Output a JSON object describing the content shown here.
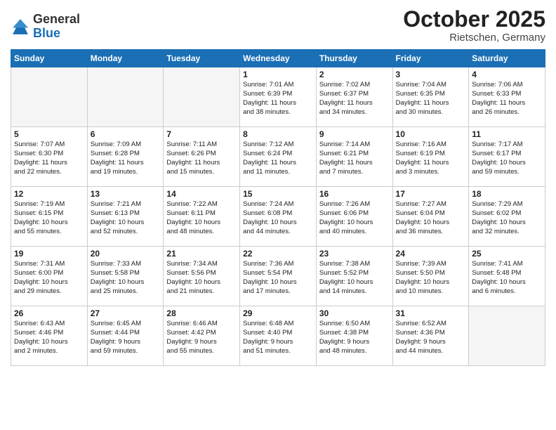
{
  "header": {
    "logo_general": "General",
    "logo_blue": "Blue",
    "month": "October 2025",
    "location": "Rietschen, Germany"
  },
  "weekdays": [
    "Sunday",
    "Monday",
    "Tuesday",
    "Wednesday",
    "Thursday",
    "Friday",
    "Saturday"
  ],
  "weeks": [
    [
      {
        "day": "",
        "info": ""
      },
      {
        "day": "",
        "info": ""
      },
      {
        "day": "",
        "info": ""
      },
      {
        "day": "1",
        "info": "Sunrise: 7:01 AM\nSunset: 6:39 PM\nDaylight: 11 hours\nand 38 minutes."
      },
      {
        "day": "2",
        "info": "Sunrise: 7:02 AM\nSunset: 6:37 PM\nDaylight: 11 hours\nand 34 minutes."
      },
      {
        "day": "3",
        "info": "Sunrise: 7:04 AM\nSunset: 6:35 PM\nDaylight: 11 hours\nand 30 minutes."
      },
      {
        "day": "4",
        "info": "Sunrise: 7:06 AM\nSunset: 6:33 PM\nDaylight: 11 hours\nand 26 minutes."
      }
    ],
    [
      {
        "day": "5",
        "info": "Sunrise: 7:07 AM\nSunset: 6:30 PM\nDaylight: 11 hours\nand 22 minutes."
      },
      {
        "day": "6",
        "info": "Sunrise: 7:09 AM\nSunset: 6:28 PM\nDaylight: 11 hours\nand 19 minutes."
      },
      {
        "day": "7",
        "info": "Sunrise: 7:11 AM\nSunset: 6:26 PM\nDaylight: 11 hours\nand 15 minutes."
      },
      {
        "day": "8",
        "info": "Sunrise: 7:12 AM\nSunset: 6:24 PM\nDaylight: 11 hours\nand 11 minutes."
      },
      {
        "day": "9",
        "info": "Sunrise: 7:14 AM\nSunset: 6:21 PM\nDaylight: 11 hours\nand 7 minutes."
      },
      {
        "day": "10",
        "info": "Sunrise: 7:16 AM\nSunset: 6:19 PM\nDaylight: 11 hours\nand 3 minutes."
      },
      {
        "day": "11",
        "info": "Sunrise: 7:17 AM\nSunset: 6:17 PM\nDaylight: 10 hours\nand 59 minutes."
      }
    ],
    [
      {
        "day": "12",
        "info": "Sunrise: 7:19 AM\nSunset: 6:15 PM\nDaylight: 10 hours\nand 55 minutes."
      },
      {
        "day": "13",
        "info": "Sunrise: 7:21 AM\nSunset: 6:13 PM\nDaylight: 10 hours\nand 52 minutes."
      },
      {
        "day": "14",
        "info": "Sunrise: 7:22 AM\nSunset: 6:11 PM\nDaylight: 10 hours\nand 48 minutes."
      },
      {
        "day": "15",
        "info": "Sunrise: 7:24 AM\nSunset: 6:08 PM\nDaylight: 10 hours\nand 44 minutes."
      },
      {
        "day": "16",
        "info": "Sunrise: 7:26 AM\nSunset: 6:06 PM\nDaylight: 10 hours\nand 40 minutes."
      },
      {
        "day": "17",
        "info": "Sunrise: 7:27 AM\nSunset: 6:04 PM\nDaylight: 10 hours\nand 36 minutes."
      },
      {
        "day": "18",
        "info": "Sunrise: 7:29 AM\nSunset: 6:02 PM\nDaylight: 10 hours\nand 32 minutes."
      }
    ],
    [
      {
        "day": "19",
        "info": "Sunrise: 7:31 AM\nSunset: 6:00 PM\nDaylight: 10 hours\nand 29 minutes."
      },
      {
        "day": "20",
        "info": "Sunrise: 7:33 AM\nSunset: 5:58 PM\nDaylight: 10 hours\nand 25 minutes."
      },
      {
        "day": "21",
        "info": "Sunrise: 7:34 AM\nSunset: 5:56 PM\nDaylight: 10 hours\nand 21 minutes."
      },
      {
        "day": "22",
        "info": "Sunrise: 7:36 AM\nSunset: 5:54 PM\nDaylight: 10 hours\nand 17 minutes."
      },
      {
        "day": "23",
        "info": "Sunrise: 7:38 AM\nSunset: 5:52 PM\nDaylight: 10 hours\nand 14 minutes."
      },
      {
        "day": "24",
        "info": "Sunrise: 7:39 AM\nSunset: 5:50 PM\nDaylight: 10 hours\nand 10 minutes."
      },
      {
        "day": "25",
        "info": "Sunrise: 7:41 AM\nSunset: 5:48 PM\nDaylight: 10 hours\nand 6 minutes."
      }
    ],
    [
      {
        "day": "26",
        "info": "Sunrise: 6:43 AM\nSunset: 4:46 PM\nDaylight: 10 hours\nand 2 minutes."
      },
      {
        "day": "27",
        "info": "Sunrise: 6:45 AM\nSunset: 4:44 PM\nDaylight: 9 hours\nand 59 minutes."
      },
      {
        "day": "28",
        "info": "Sunrise: 6:46 AM\nSunset: 4:42 PM\nDaylight: 9 hours\nand 55 minutes."
      },
      {
        "day": "29",
        "info": "Sunrise: 6:48 AM\nSunset: 4:40 PM\nDaylight: 9 hours\nand 51 minutes."
      },
      {
        "day": "30",
        "info": "Sunrise: 6:50 AM\nSunset: 4:38 PM\nDaylight: 9 hours\nand 48 minutes."
      },
      {
        "day": "31",
        "info": "Sunrise: 6:52 AM\nSunset: 4:36 PM\nDaylight: 9 hours\nand 44 minutes."
      },
      {
        "day": "",
        "info": ""
      }
    ]
  ]
}
